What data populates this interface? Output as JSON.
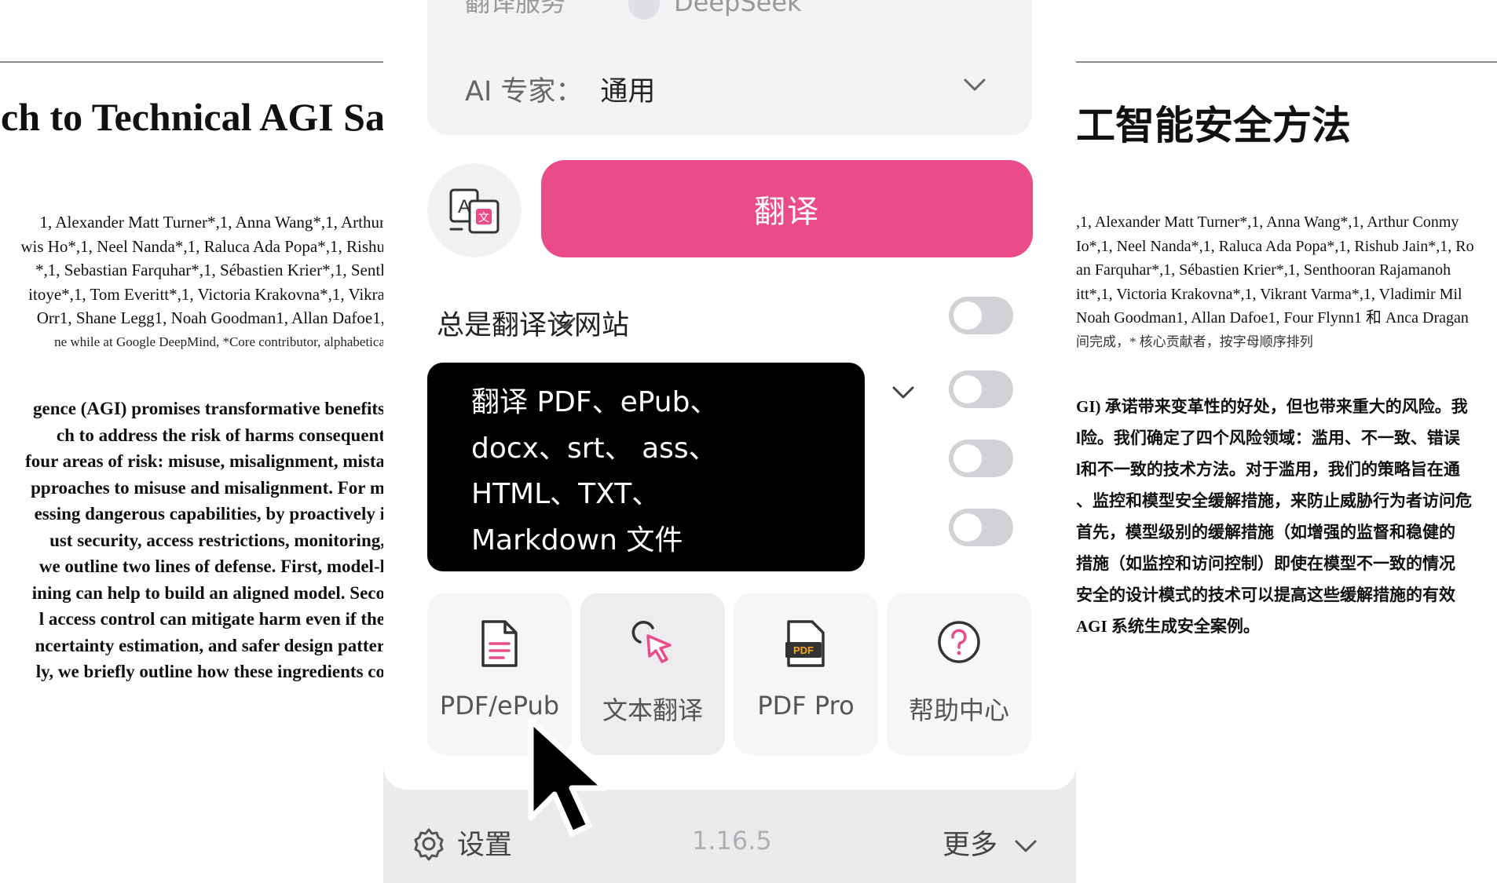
{
  "document_left": {
    "title": "ch to Technical AGI Sa",
    "authors": [
      "1, Alexander Matt Turner*,1, Anna Wang*,1, Arthur",
      "wis Ho*,1, Neel Nanda*,1, Raluca Ada Popa*,1, Rishu",
      "*,1, Sebastian Farquhar*,1, Sébastien Krier*,1, Sentl",
      "itoye*,1, Tom Everitt*,1, Victoria Krakovna*,1, Vikra",
      "Orr1, Shane Legg1, Noah Goodman1, Allan Dafoe1,"
    ],
    "author_note": "ne while at Google DeepMind, *Core contributor, alphabetica",
    "abstract": [
      "gence (AGI) promises transformative benefits",
      "ch to address the risk of harms consequent",
      "four areas of risk: misuse, misalignment, mista",
      "pproaches to misuse and misalignment. For m",
      "essing dangerous capabilities, by proactively i",
      "ust security, access restrictions, monitoring,",
      "we outline two lines of defense. First, model-l",
      "ining can help to build an aligned model. Seco",
      "l access control can mitigate harm even if the",
      "ncertainty estimation, and safer design patter",
      "ly, we briefly outline how these ingredients co"
    ]
  },
  "document_right": {
    "title": "工智能安全方法",
    "authors": [
      ",1, Alexander Matt Turner*,1, Anna Wang*,1, Arthur Conmy",
      "Io*,1, Neel Nanda*,1, Raluca Ada Popa*,1, Rishub Jain*,1, Ro",
      "an Farquhar*,1, Sébastien Krier*,1, Senthooran Rajamanoh",
      "itt*,1, Victoria Krakovna*,1, Vikrant Varma*,1, Vladimir Mil",
      "Noah Goodman1, Allan Dafoe1, Four Flynn1 和 Anca Dragan"
    ],
    "author_note": "间完成，* 核心贡献者，按字母顺序排列",
    "abstract": [
      "GI) 承诺带来变革性的好处，但也带来重大的风险。我",
      "l险。我们确定了四个风险领域：滥用、不一致、错误",
      "l和不一致的技术方法。对于滥用，我们的策略旨在通",
      "、监控和模型安全缓解措施，来防止威胁行为者访问危",
      "首先，模型级别的缓解措施（如增强的监督和稳健的",
      "措施（如监控和访问控制）即使在模型不一致的情况",
      "安全的设计模式的技术可以提高这些缓解措施的有效",
      "AGI 系统生成安全案例。"
    ]
  },
  "popup": {
    "service_label": "翻译服务",
    "service_value": "DeepSeek",
    "expert_label": "AI 专家：",
    "expert_value": "通用",
    "translate_label": "翻译",
    "always_translate_label": "总是翻译该网站",
    "toggles": [
      false,
      false,
      false,
      false
    ],
    "tooltip_lines": [
      "翻译 PDF、ePub、",
      "docx、srt、 ass、",
      "HTML、TXT、",
      "Markdown 文件"
    ],
    "tools": [
      {
        "label": "PDF/ePub",
        "icon": "document-icon"
      },
      {
        "label": "文本翻译",
        "icon": "cursor-select-icon"
      },
      {
        "label": "PDF Pro",
        "icon": "pdf-icon"
      },
      {
        "label": "帮助中心",
        "icon": "help-icon"
      }
    ],
    "settings_label": "设置",
    "version": "1.16.5",
    "more_label": "更多"
  },
  "colors": {
    "accent": "#ea4c89",
    "tooltip_bg": "#000000",
    "toggle_off": "#d2d2d6"
  }
}
